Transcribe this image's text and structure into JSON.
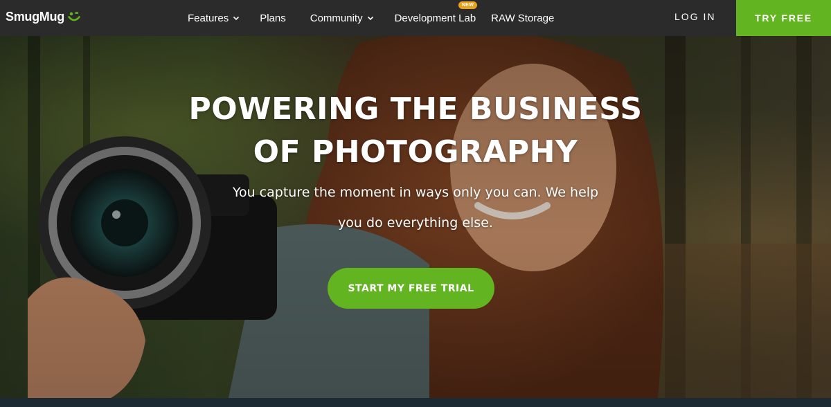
{
  "brand": {
    "name": "SmugMug",
    "accent": "#62b420",
    "badge_color": "#e9a21c",
    "nav_bg": "#2b2b2b"
  },
  "nav": {
    "items": [
      {
        "label": "Features",
        "has_dropdown": true
      },
      {
        "label": "Plans",
        "has_dropdown": false
      },
      {
        "label": "Community",
        "has_dropdown": true
      },
      {
        "label": "Development Lab",
        "badge": "NEW"
      },
      {
        "label": "RAW Storage",
        "has_dropdown": false
      }
    ],
    "login_label": "LOG IN",
    "try_free_label": "TRY FREE"
  },
  "hero": {
    "title_line1": "POWERING THE BUSINESS",
    "title_line2": "OF PHOTOGRAPHY",
    "subtitle_line1": "You capture the moment in ways only you can. We help",
    "subtitle_line2": "you do everything else.",
    "cta_label": "START MY FREE TRIAL",
    "background_icon": "photographer-with-camera-photo"
  }
}
